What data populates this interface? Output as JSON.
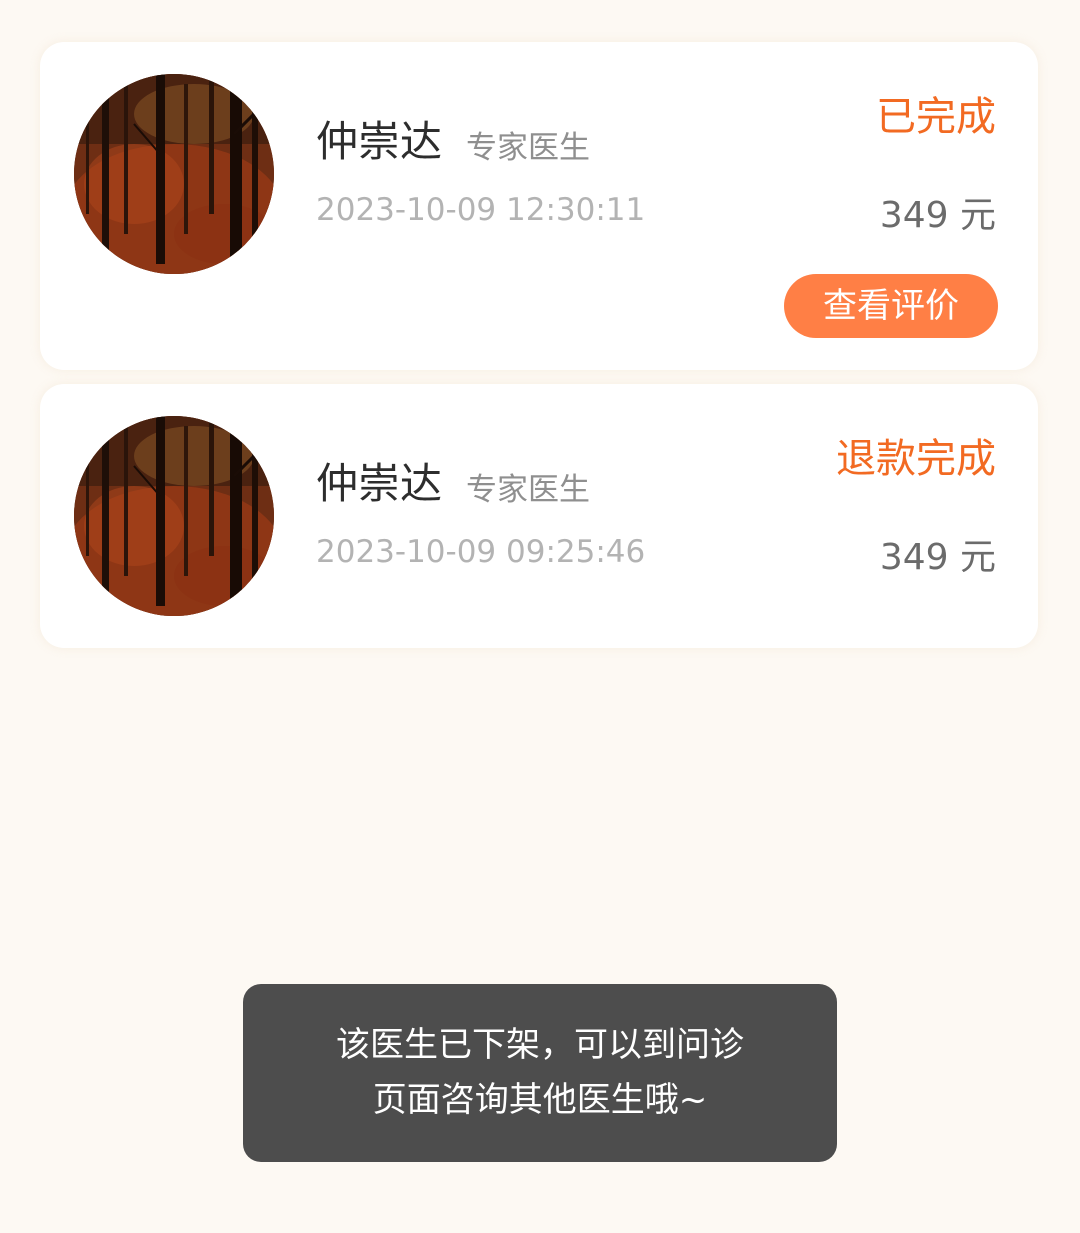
{
  "orders": [
    {
      "doctor_name": "仲崇达",
      "doctor_title": "专家医生",
      "time": "2023-10-09 12:30:11",
      "status": "已完成",
      "price": "349 元",
      "action_label": "查看评价",
      "avatar_icon": "forest-photo-avatar"
    },
    {
      "doctor_name": "仲崇达",
      "doctor_title": "专家医生",
      "time": "2023-10-09 09:25:46",
      "status": "退款完成",
      "price": "349 元",
      "avatar_icon": "forest-photo-avatar"
    }
  ],
  "toast": {
    "line1": "该医生已下架，可以到问诊",
    "line2": "页面咨询其他医生哦~"
  },
  "colors": {
    "background": "#fdf9f3",
    "card": "#ffffff",
    "accent": "#f26a22",
    "button": "#ff7f45",
    "toast": "#4d4d4d"
  }
}
